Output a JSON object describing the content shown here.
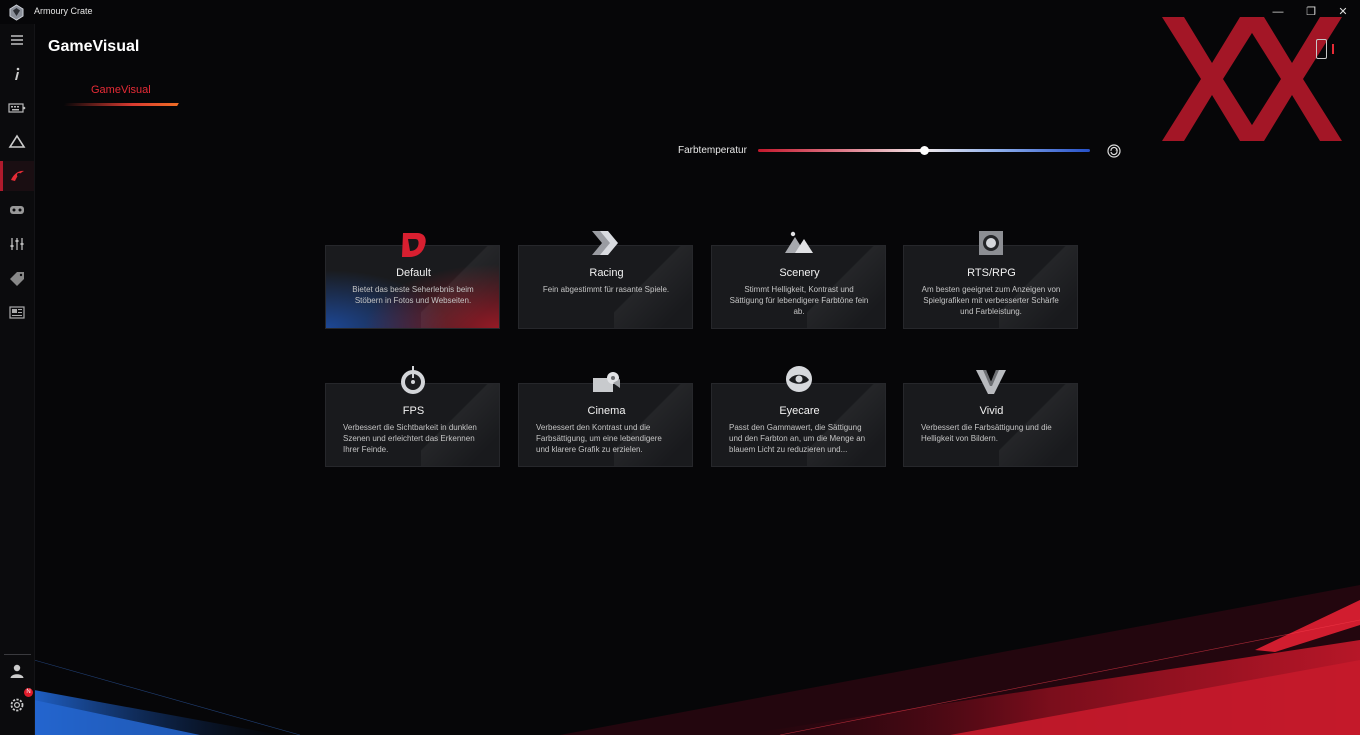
{
  "window": {
    "title": "Armoury Crate",
    "minimize": "—",
    "maximize": "❐",
    "close": "✕"
  },
  "sidebar": {
    "items": [
      {
        "icon": "hamburger-menu-icon"
      },
      {
        "icon": "info-icon"
      },
      {
        "icon": "keyboard-device-icon"
      },
      {
        "icon": "aura-triangle-icon"
      },
      {
        "icon": "gamevisual-icon",
        "active": true
      },
      {
        "icon": "gamepad-icon"
      },
      {
        "icon": "equalizer-sliders-icon"
      },
      {
        "icon": "deals-tag-icon"
      },
      {
        "icon": "news-icon"
      }
    ],
    "bottom": [
      {
        "icon": "user-profile-icon"
      },
      {
        "icon": "settings-gear-icon",
        "badge": "N"
      }
    ]
  },
  "header": {
    "title": "GameVisual",
    "tabs": [
      {
        "label": "GameVisual",
        "active": true
      }
    ]
  },
  "color_temperature": {
    "label": "Farbtemperatur",
    "value_fraction": 0.5
  },
  "modes": [
    {
      "name": "Default",
      "icon": "default-d-icon",
      "selected": true,
      "description": "Bietet das beste Seherlebnis beim Stöbern in Fotos und Webseiten."
    },
    {
      "name": "Racing",
      "icon": "racing-arrows-icon",
      "description": "Fein abgestimmt für rasante Spiele."
    },
    {
      "name": "Scenery",
      "icon": "scenery-mountains-icon",
      "description": "Stimmt Helligkeit, Kontrast und Sättigung für lebendigere Farbtöne fein ab."
    },
    {
      "name": "RTS/RPG",
      "icon": "rts-rpg-icon",
      "description": "Am besten geeignet zum Anzeigen von Spielgrafiken mit verbesserter Schärfe und Farbleistung."
    },
    {
      "name": "FPS",
      "icon": "fps-crosshair-icon",
      "description": "Verbessert die Sichtbarkeit in dunklen Szenen und erleichtert das Erkennen Ihrer Feinde."
    },
    {
      "name": "Cinema",
      "icon": "cinema-icon",
      "description": "Verbessert den Kontrast und die Farbsättigung, um eine lebendigere und klarere Grafik zu erzielen."
    },
    {
      "name": "Eyecare",
      "icon": "eyecare-eye-icon",
      "description": "Passt den Gammawert, die Sättigung und den Farbton an, um die Menge an blauem Licht zu reduzieren und..."
    },
    {
      "name": "Vivid",
      "icon": "vivid-v-icon",
      "description": "Verbessert die Farbsättigung und die Helligkeit von Bildern."
    }
  ],
  "colors": {
    "accent": "#e52b36",
    "background": "#060608",
    "card": "#191a1d"
  }
}
